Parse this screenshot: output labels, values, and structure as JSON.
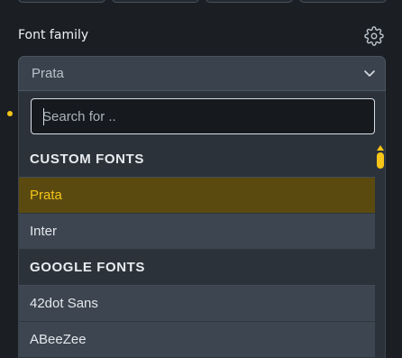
{
  "font_family": {
    "label": "Font family",
    "settings_icon": "gear-icon",
    "selected_value": "Prata",
    "dropdown_icon": "chevron-down-icon"
  },
  "dropdown": {
    "search_placeholder": "Search for ..",
    "groups": [
      {
        "heading": "CUSTOM FONTS",
        "items": [
          "Prata",
          "Inter"
        ]
      },
      {
        "heading": "GOOGLE FONTS",
        "items": [
          "42dot Sans",
          "ABeeZee"
        ]
      }
    ],
    "selected_item": "Prata"
  },
  "colors": {
    "accent": "#f5c518",
    "selected_bg": "#5b4a10",
    "panel_bg": "#2b323a",
    "item_bg": "#3c4550"
  }
}
